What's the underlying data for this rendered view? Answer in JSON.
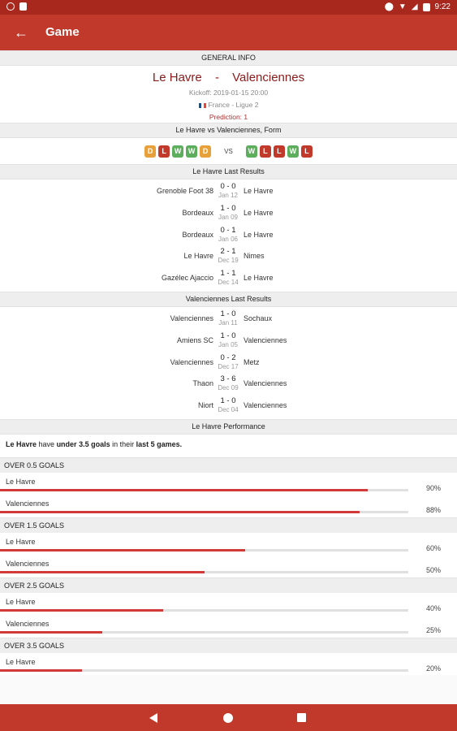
{
  "status": {
    "time": "9:22"
  },
  "appbar": {
    "title": "Game"
  },
  "general": {
    "header": "GENERAL INFO",
    "home": "Le Havre",
    "sep": "-",
    "away": "Valenciennes",
    "kickoff": "Kickoff: 2019-01-15 20:00",
    "league": "France - Ligue 2",
    "prediction": "Prediction: 1"
  },
  "form": {
    "header": "Le Havre vs Valenciennes, Form",
    "vs": "VS",
    "home": [
      {
        "r": "D",
        "color": "#e8a13a"
      },
      {
        "r": "L",
        "color": "#c0392b"
      },
      {
        "r": "W",
        "color": "#5cae5c"
      },
      {
        "r": "W",
        "color": "#5cae5c"
      },
      {
        "r": "D",
        "color": "#e8a13a"
      }
    ],
    "away": [
      {
        "r": "W",
        "color": "#5cae5c"
      },
      {
        "r": "L",
        "color": "#c0392b"
      },
      {
        "r": "L",
        "color": "#c0392b"
      },
      {
        "r": "W",
        "color": "#5cae5c"
      },
      {
        "r": "L",
        "color": "#c0392b"
      }
    ]
  },
  "lh_results": {
    "header": "Le Havre Last Results",
    "rows": [
      {
        "home": "Grenoble Foot 38",
        "score": "0 - 0",
        "date": "Jan 12",
        "away": "Le Havre"
      },
      {
        "home": "Bordeaux",
        "score": "1 - 0",
        "date": "Jan 09",
        "away": "Le Havre"
      },
      {
        "home": "Bordeaux",
        "score": "0 - 1",
        "date": "Jan 06",
        "away": "Le Havre"
      },
      {
        "home": "Le Havre",
        "score": "2 - 1",
        "date": "Dec 19",
        "away": "Nimes"
      },
      {
        "home": "Gazélec Ajaccio",
        "score": "1 - 1",
        "date": "Dec 14",
        "away": "Le Havre"
      }
    ]
  },
  "va_results": {
    "header": "Valenciennes Last Results",
    "rows": [
      {
        "home": "Valenciennes",
        "score": "1 - 0",
        "date": "Jan 11",
        "away": "Sochaux"
      },
      {
        "home": "Amiens SC",
        "score": "1 - 0",
        "date": "Jan 05",
        "away": "Valenciennes"
      },
      {
        "home": "Valenciennes",
        "score": "0 - 2",
        "date": "Dec 17",
        "away": "Metz"
      },
      {
        "home": "Thaon",
        "score": "3 - 6",
        "date": "Dec 09",
        "away": "Valenciennes"
      },
      {
        "home": "Niort",
        "score": "1 - 0",
        "date": "Dec 04",
        "away": "Valenciennes"
      }
    ]
  },
  "performance": {
    "header": "Le Havre Performance",
    "text_team": "Le Havre",
    "text_mid1": " have ",
    "text_goals": "under 3.5 goals",
    "text_mid2": " in their ",
    "text_games": "last 5 games.",
    "groups": [
      {
        "title": "OVER 0.5 GOALS",
        "rows": [
          {
            "team": "Le Havre",
            "pct_label": "90%",
            "pct": 90
          },
          {
            "team": "Valenciennes",
            "pct_label": "88%",
            "pct": 88
          }
        ]
      },
      {
        "title": "OVER 1.5 GOALS",
        "rows": [
          {
            "team": "Le Havre",
            "pct_label": "60%",
            "pct": 60
          },
          {
            "team": "Valenciennes",
            "pct_label": "50%",
            "pct": 50
          }
        ]
      },
      {
        "title": "OVER 2.5 GOALS",
        "rows": [
          {
            "team": "Le Havre",
            "pct_label": "40%",
            "pct": 40
          },
          {
            "team": "Valenciennes",
            "pct_label": "25%",
            "pct": 25
          }
        ]
      },
      {
        "title": "OVER 3.5 GOALS",
        "rows": [
          {
            "team": "Le Havre",
            "pct_label": "20%",
            "pct": 20
          }
        ]
      }
    ]
  }
}
